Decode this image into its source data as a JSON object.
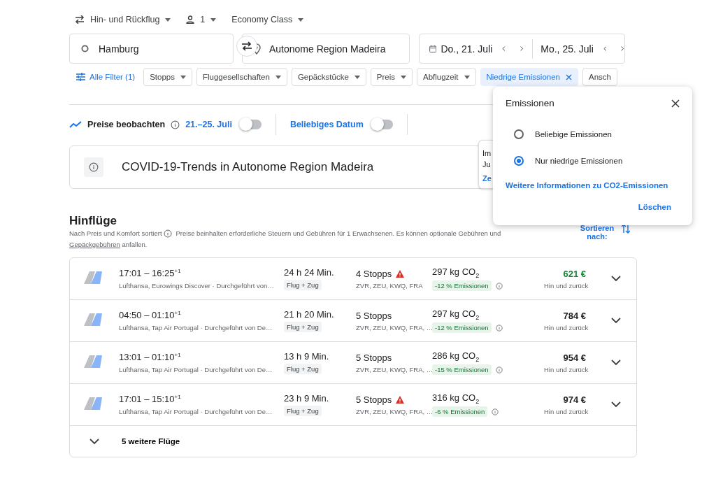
{
  "trip_options": [
    {
      "kind": "trip",
      "label": "Hin- und Rückflug"
    },
    {
      "kind": "passengers",
      "label": "1"
    },
    {
      "kind": "class",
      "label": "Economy Class"
    }
  ],
  "search": {
    "origin": "Hamburg",
    "destination": "Autonome Region Madeira",
    "depart": "Do., 21. Juli",
    "return": "Mo., 25. Juli"
  },
  "filters": [
    {
      "kind": "all",
      "label": "Alle Filter (1)",
      "active": false
    },
    {
      "kind": "dropdown",
      "label": "Stopps",
      "active": false
    },
    {
      "kind": "dropdown",
      "label": "Fluggesellschaften",
      "active": false
    },
    {
      "kind": "dropdown",
      "label": "Gepäckstücke",
      "active": false
    },
    {
      "kind": "dropdown",
      "label": "Preis",
      "active": false
    },
    {
      "kind": "dropdown",
      "label": "Abflugzeit",
      "active": false
    },
    {
      "kind": "dropdown",
      "label": "Niedrige Emissionen",
      "active": true
    },
    {
      "kind": "dropdown",
      "label": "Ansch",
      "active": false
    }
  ],
  "tracker": {
    "label": "Preise beobachten",
    "dates": "21.–25. Juli",
    "dates_on": false,
    "any_date": "Beliebiges Datum",
    "any_date_on": false
  },
  "covid": {
    "title": "COVID-19-Trends in Autonome Region Madeira"
  },
  "behind_card": {
    "lines": [
      "Im",
      "Ju"
    ],
    "link": "Ze"
  },
  "results": {
    "title": "Hinflüge",
    "sorted": "Nach Preis und Komfort sortiert",
    "note": "Preise beinhalten erforderliche Steuern und Gebühren für 1 Erwachsenen. Es können optionale Gebühren und",
    "fees_link": "Gepäckgebühren",
    "note_end": "anfallen.",
    "sort_label": "Sortieren nach:",
    "flights": [
      {
        "times": "17:01 – 16:25$^{+1}$",
        "airlines": "Lufthansa, Eurowings Discover · Durchgeführt von…",
        "duration": "24 h 24 Min.",
        "type": "Flug + Zug",
        "stops": "4 Stopps",
        "warning": true,
        "airports": "ZVR, ZEU, KWQ, FRA",
        "co2": "297 kg CO$_{2}$",
        "emissions": "-12 % Emissionen",
        "price": "621 €",
        "cheapest": true,
        "price_note": "Hin und zurück"
      },
      {
        "times": "04:50 – 01:10$^{+1}$",
        "airlines": "Lufthansa, Tap Air Portugal · Durchgeführt von De…",
        "duration": "21 h 20 Min.",
        "type": "Flug + Zug",
        "stops": "5 Stopps",
        "warning": false,
        "airports": "ZVR, ZEU, KWQ, FRA, …",
        "co2": "297 kg CO$_{2}$",
        "emissions": "-12 % Emissionen",
        "price": "784 €",
        "cheapest": false,
        "price_note": "Hin und zurück"
      },
      {
        "times": "13:01 – 01:10$^{+1}$",
        "airlines": "Lufthansa, Tap Air Portugal · Durchgeführt von De…",
        "duration": "13 h 9 Min.",
        "type": "Flug + Zug",
        "stops": "5 Stopps",
        "warning": false,
        "airports": "ZVR, ZEU, KWQ, FRA, …",
        "co2": "286 kg CO$_{2}$",
        "emissions": "-15 % Emissionen",
        "price": "954 €",
        "cheapest": false,
        "price_note": "Hin und zurück"
      },
      {
        "times": "17:01 – 15:10$^{+1}$",
        "airlines": "Lufthansa, Tap Air Portugal · Durchgeführt von De…",
        "duration": "23 h 9 Min.",
        "type": "Flug + Zug",
        "stops": "5 Stopps",
        "warning": true,
        "airports": "ZVR, ZEU, KWQ, FRA, …",
        "co2": "316 kg CO$_{2}$",
        "emissions": "-6 % Emissionen",
        "price": "974 €",
        "cheapest": false,
        "price_note": "Hin und zurück"
      }
    ],
    "more": "5 weitere Flüge"
  },
  "popup": {
    "title": "Emissionen",
    "options": [
      {
        "label": "Beliebige Emissionen",
        "selected": false
      },
      {
        "label": "Nur niedrige Emissionen",
        "selected": true
      }
    ],
    "link": "Weitere Informationen zu CO2-Emissionen",
    "clear": "Löschen"
  }
}
